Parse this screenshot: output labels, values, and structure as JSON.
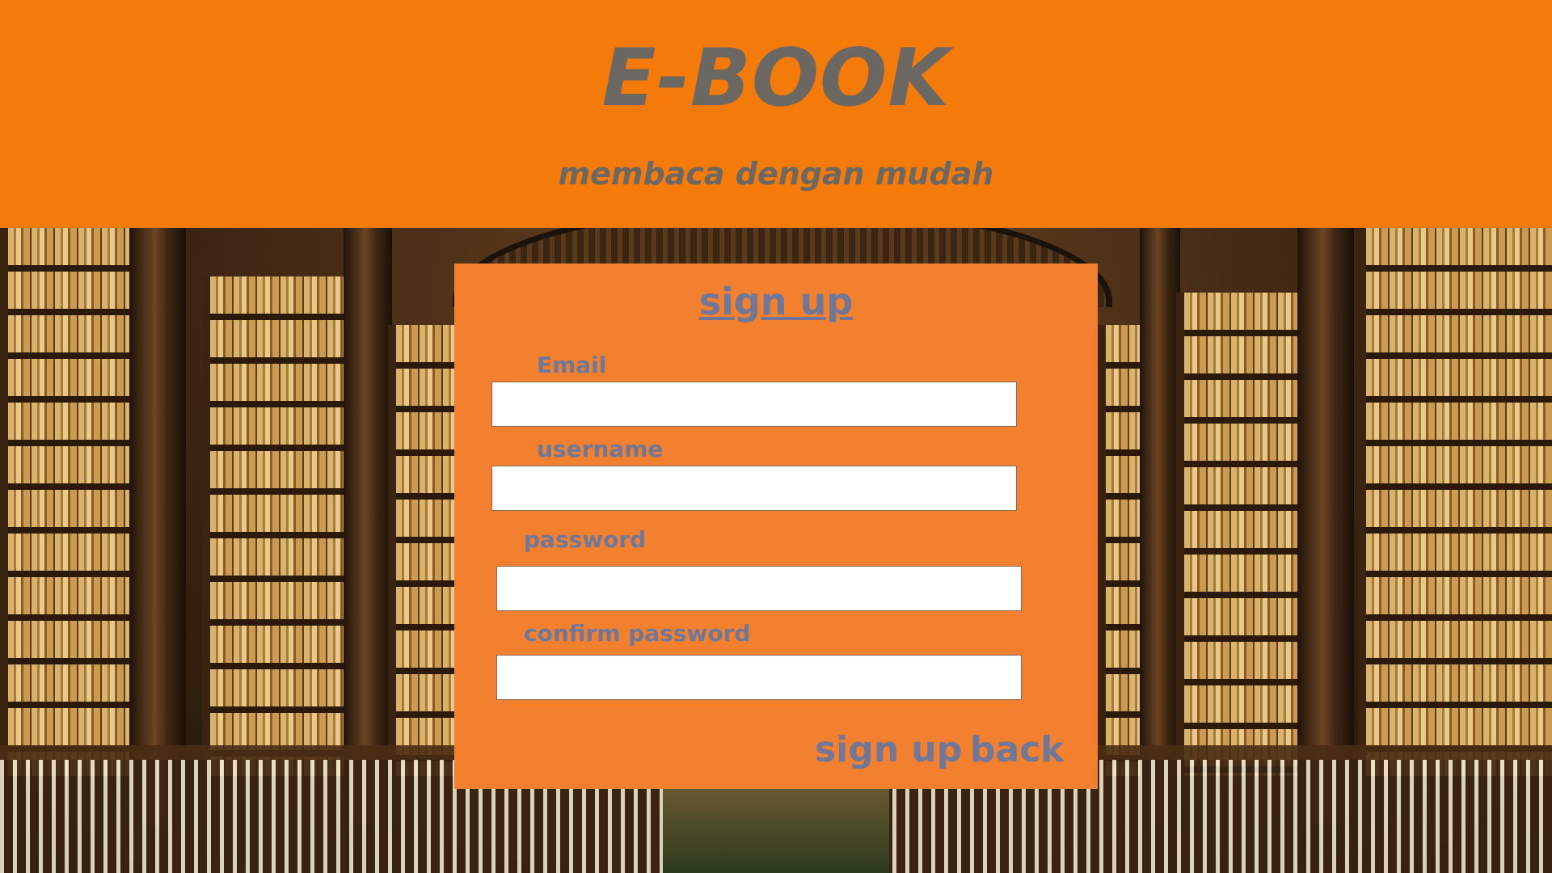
{
  "header": {
    "title": "E-BOOK",
    "subtitle": "membaca dengan mudah"
  },
  "form": {
    "title": "sign up",
    "fields": [
      {
        "label": "Email",
        "value": ""
      },
      {
        "label": "username",
        "value": ""
      },
      {
        "label": "password",
        "value": ""
      },
      {
        "label": "confirm password",
        "value": ""
      }
    ],
    "signup_label": "sign up",
    "back_label": "back"
  },
  "colors": {
    "header_bg": "#f47b0a",
    "panel_bg": "#f2802f",
    "label_text": "#6f7898",
    "title_text": "#6b6763"
  }
}
